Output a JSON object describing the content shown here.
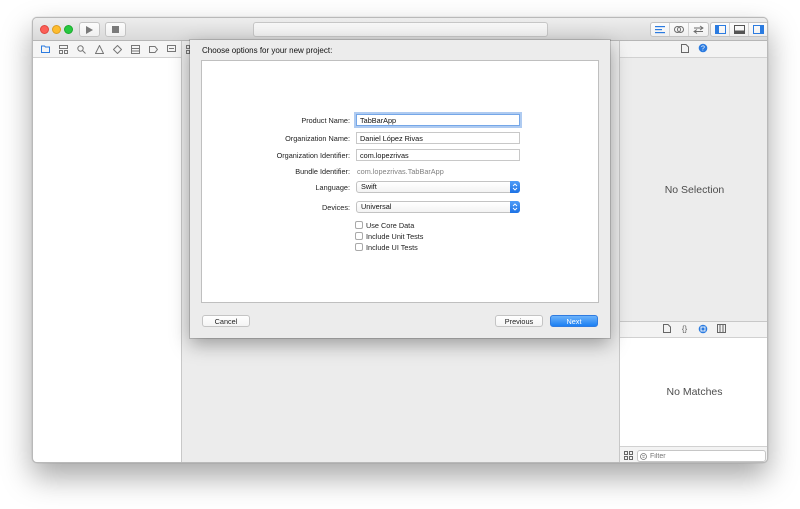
{
  "sheet": {
    "title": "Choose options for your new project:",
    "form": {
      "product_name_label": "Product Name:",
      "product_name_value": "TabBarApp",
      "organization_name_label": "Organization Name:",
      "organization_name_value": "Daniel López Rivas",
      "organization_identifier_label": "Organization Identifier:",
      "organization_identifier_value": "com.lopezrivas",
      "bundle_identifier_label": "Bundle Identifier:",
      "bundle_identifier_value": "com.lopezrivas.TabBarApp",
      "language_label": "Language:",
      "language_value": "Swift",
      "devices_label": "Devices:",
      "devices_value": "Universal",
      "checkboxes": [
        {
          "label": "Use Core Data",
          "checked": false
        },
        {
          "label": "Include Unit Tests",
          "checked": false
        },
        {
          "label": "Include UI Tests",
          "checked": false
        }
      ]
    },
    "buttons": {
      "cancel": "Cancel",
      "previous": "Previous",
      "next": "Next"
    }
  },
  "utilities": {
    "inspector_empty": "No Selection",
    "library_empty": "No Matches",
    "filter_placeholder": "Filter"
  },
  "colors": {
    "accent": "#1b7ff3",
    "close": "#fc5f57",
    "minimize": "#fdbc2e",
    "zoom": "#27c840"
  }
}
